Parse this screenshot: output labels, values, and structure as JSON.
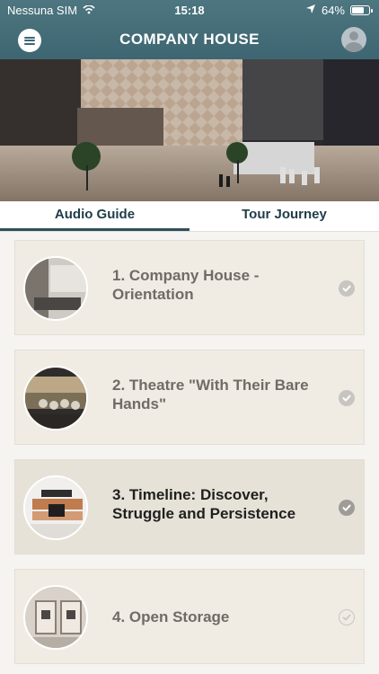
{
  "status_bar": {
    "carrier": "Nessuna SIM",
    "time": "15:18",
    "battery_percent": "64%",
    "battery_level": 0.64
  },
  "app_bar": {
    "title": "COMPANY HOUSE",
    "menu_icon": "menu-icon",
    "avatar_icon": "user-avatar-icon"
  },
  "tabs": [
    {
      "label": "Audio Guide",
      "selected": true
    },
    {
      "label": "Tour Journey",
      "selected": false
    }
  ],
  "items": [
    {
      "title": "1. Company House - Orientation",
      "status": "checked"
    },
    {
      "title": "2. Theatre \"With Their Bare Hands\"",
      "status": "checked"
    },
    {
      "title": "3. Timeline: Discover, Struggle and Persistence",
      "status": "checked-active"
    },
    {
      "title": "4. Open Storage",
      "status": "unchecked"
    }
  ],
  "colors": {
    "header": "#3e6672",
    "tab_underline": "#2f4f5c",
    "card": "#f0ece3",
    "card_active": "#e7e2d8"
  }
}
